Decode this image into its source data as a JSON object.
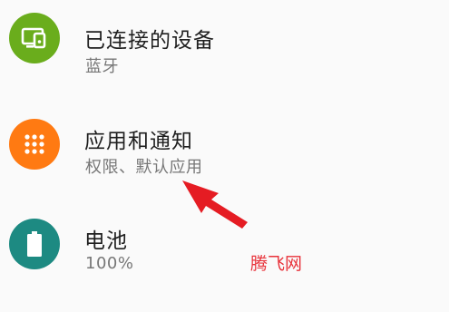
{
  "settings": {
    "items": [
      {
        "title": "已连接的设备",
        "subtitle": "蓝牙",
        "icon": "connected-devices-icon",
        "icon_color": "#6aad1c"
      },
      {
        "title": "应用和通知",
        "subtitle": "权限、默认应用",
        "icon": "apps-grid-icon",
        "icon_color": "#ff7a12"
      },
      {
        "title": "电池",
        "subtitle": "100%",
        "icon": "battery-icon",
        "icon_color": "#1d8a82"
      }
    ]
  },
  "annotation": {
    "arrow_color": "#e51c23",
    "watermark": "腾飞网"
  }
}
